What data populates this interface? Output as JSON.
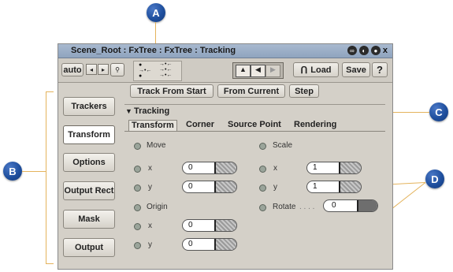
{
  "callouts": {
    "a": "A",
    "b": "B",
    "c": "C",
    "d": "D"
  },
  "window": {
    "title": "Scene_Root : FxTree : FxTree : Tracking",
    "close_glyph": "x",
    "toolbar": {
      "auto": "auto",
      "prev": "◂",
      "next": "▸",
      "load": "Load",
      "save": "Save",
      "help": "?"
    }
  },
  "actions": {
    "track_from_start": "Track From Start",
    "from_current": "From Current",
    "step": "Step"
  },
  "sidebar": [
    "Trackers",
    "Transform",
    "Options",
    "Output Rect",
    "Mask",
    "Output"
  ],
  "section": {
    "title": "Tracking"
  },
  "tabs": [
    "Transform",
    "Corner",
    "Source Point",
    "Rendering"
  ],
  "fields": {
    "move": "Move",
    "move_x_label": "x",
    "move_x": "0",
    "move_y_label": "y",
    "move_y": "0",
    "origin": "Origin",
    "origin_x_label": "x",
    "origin_x": "0",
    "origin_y_label": "y",
    "origin_y": "0",
    "scale": "Scale",
    "scale_x_label": "x",
    "scale_x": "1",
    "scale_y_label": "y",
    "scale_y": "1",
    "rotate": "Rotate",
    "rotate_dots": ". . . .",
    "rotate_val": "0"
  },
  "colors": {
    "callout": "#1f4f9e",
    "leader": "#e4b35c",
    "title_bar": "#8fa4bf",
    "window_bg": "#d4d0c8"
  }
}
